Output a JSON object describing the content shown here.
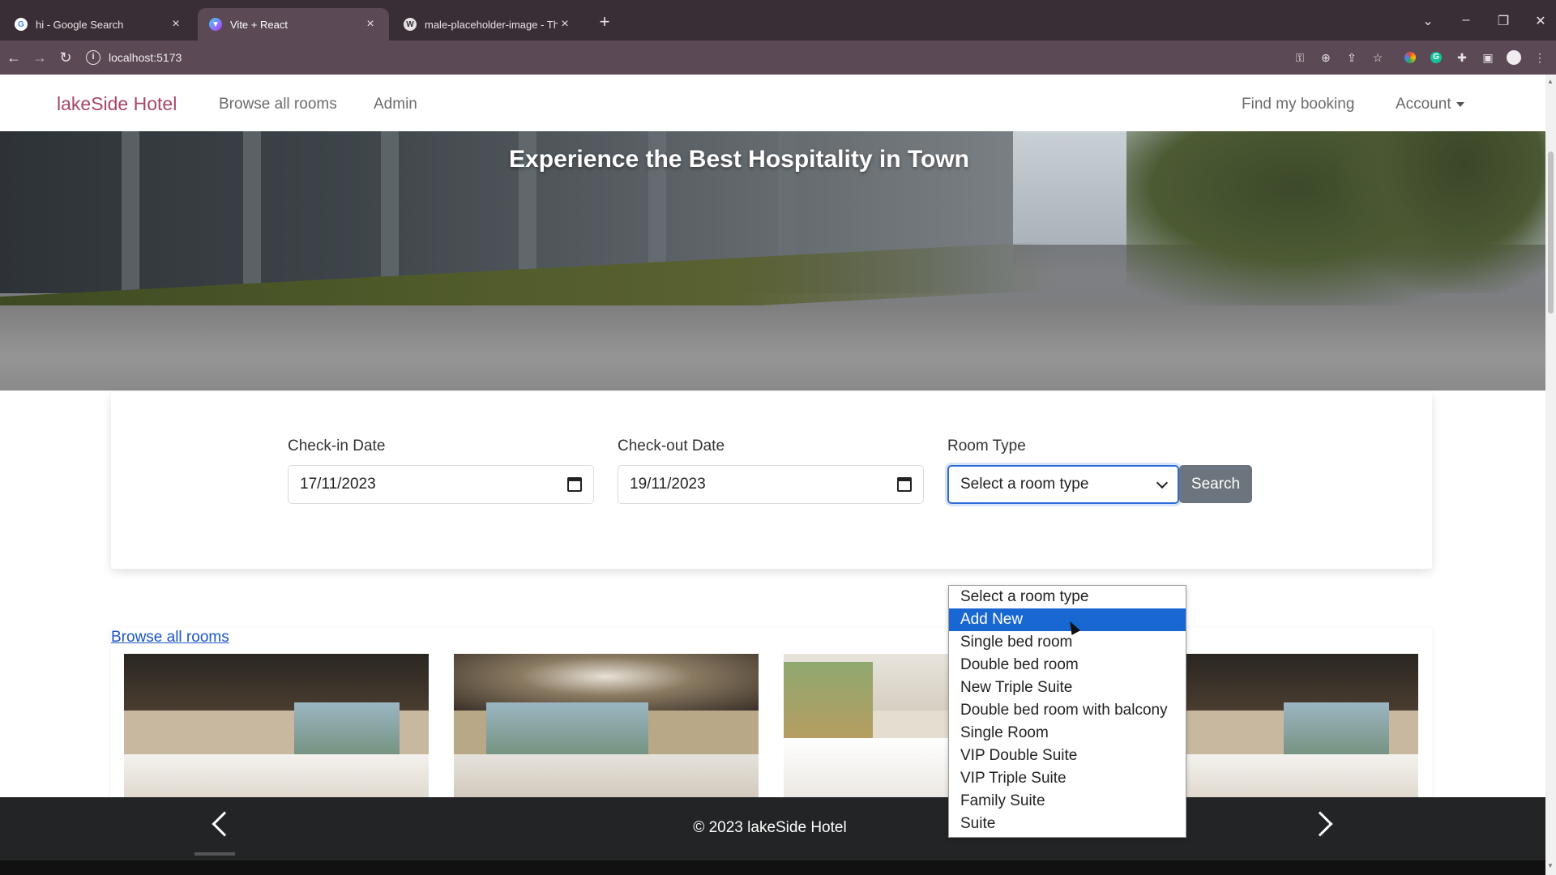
{
  "browser": {
    "tabs": [
      {
        "title": "hi - Google Search",
        "favicon": "google-icon",
        "active": false
      },
      {
        "title": "Vite + React",
        "favicon": "vite-icon",
        "active": true
      },
      {
        "title": "male-placeholder-image - The I",
        "favicon": "wikipedia-icon",
        "active": false
      }
    ],
    "url": "localhost:5173"
  },
  "navbar": {
    "brand": "lakeSide Hotel",
    "links": [
      "Browse all rooms",
      "Admin"
    ],
    "right_links": [
      "Find my booking"
    ],
    "account_label": "Account"
  },
  "hero": {
    "title": "Experience the Best Hospitality in Town"
  },
  "search": {
    "checkin_label": "Check-in Date",
    "checkin_value": "17/11/2023",
    "checkout_label": "Check-out Date",
    "checkout_value": "19/11/2023",
    "room_type_label": "Room Type",
    "room_type_value": "Select a room type",
    "search_button": "Search",
    "room_type_options": [
      "Select a room type",
      "Add New",
      "Single bed room",
      "Double bed room",
      "New Triple Suite",
      "Double bed room with balcony",
      "Single Room",
      "VIP Double Suite",
      "VIP Triple Suite",
      "Family Suite",
      "Suite"
    ],
    "highlighted_option": "Add New"
  },
  "rooms": {
    "browse_link": "Browse all rooms"
  },
  "footer": {
    "text": "© 2023 lakeSide Hotel"
  },
  "colors": {
    "brand": "#a5466a",
    "select_focus": "#2c6ad8",
    "dropdown_highlight": "#1967d2",
    "search_button": "#6c757d",
    "footer_bg": "#222426",
    "link": "#1a56c7"
  }
}
